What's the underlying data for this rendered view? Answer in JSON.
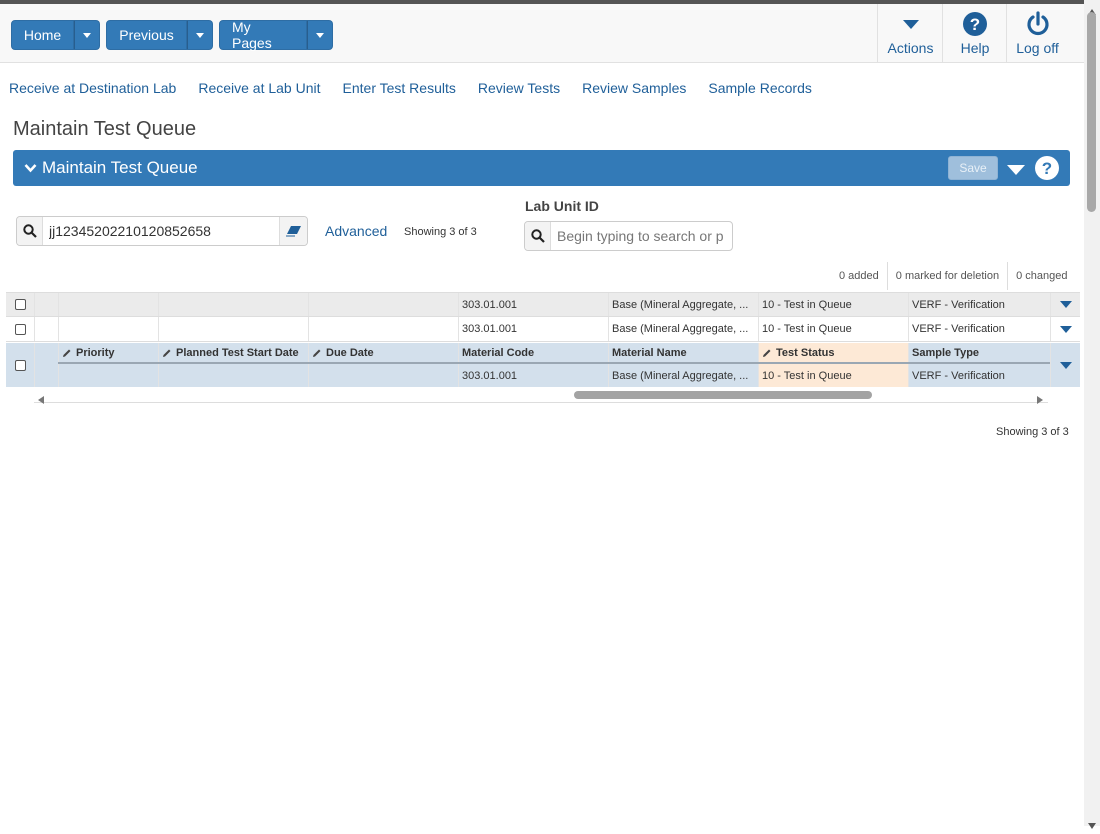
{
  "header": {
    "buttons": {
      "home": "Home",
      "previous": "Previous",
      "my_pages": "My Pages"
    },
    "actions": {
      "actions": "Actions",
      "help": "Help",
      "log_off": "Log off"
    }
  },
  "nav": {
    "links": [
      "Receive at Destination Lab",
      "Receive at Lab Unit",
      "Enter Test Results",
      "Review Tests",
      "Review Samples",
      "Sample Records"
    ]
  },
  "page": {
    "title": "Maintain Test Queue"
  },
  "panel": {
    "title": "Maintain Test Queue",
    "save_label": "Save"
  },
  "search": {
    "value": "jj12345202210120852658",
    "advanced_label": "Advanced",
    "showing": "Showing 3 of 3"
  },
  "lab_unit": {
    "label": "Lab Unit ID",
    "placeholder": "Begin typing to search or pr"
  },
  "counts": {
    "added": "0 added",
    "marked": "0 marked for deletion",
    "changed": "0 changed"
  },
  "grid": {
    "columns": {
      "priority": "Priority",
      "planned": "Planned Test Start Date",
      "due": "Due Date",
      "material_code": "Material Code",
      "material_name": "Material Name",
      "test_status": "Test Status",
      "sample_type": "Sample Type"
    },
    "rows": [
      {
        "material_code": "303.01.001",
        "material_name": "Base (Mineral Aggregate, ...",
        "test_status": "10 - Test in Queue",
        "sample_type": "VERF - Verification"
      },
      {
        "material_code": "303.01.001",
        "material_name": "Base (Mineral Aggregate, ...",
        "test_status": "10 - Test in Queue",
        "sample_type": "VERF - Verification"
      },
      {
        "material_code": "303.01.001",
        "material_name": "Base (Mineral Aggregate, ...",
        "test_status": "10 - Test in Queue",
        "sample_type": "VERF - Verification"
      }
    ],
    "showing_bottom": "Showing 3 of 3"
  },
  "colors": {
    "primary": "#337ab7",
    "link": "#1f5f99",
    "selected_row": "#d3e0ec",
    "status_highlight": "#fde9d6"
  },
  "icons": [
    "chevron-down-icon",
    "help-circle-icon",
    "power-icon",
    "search-icon",
    "eraser-icon",
    "pencil-icon"
  ]
}
